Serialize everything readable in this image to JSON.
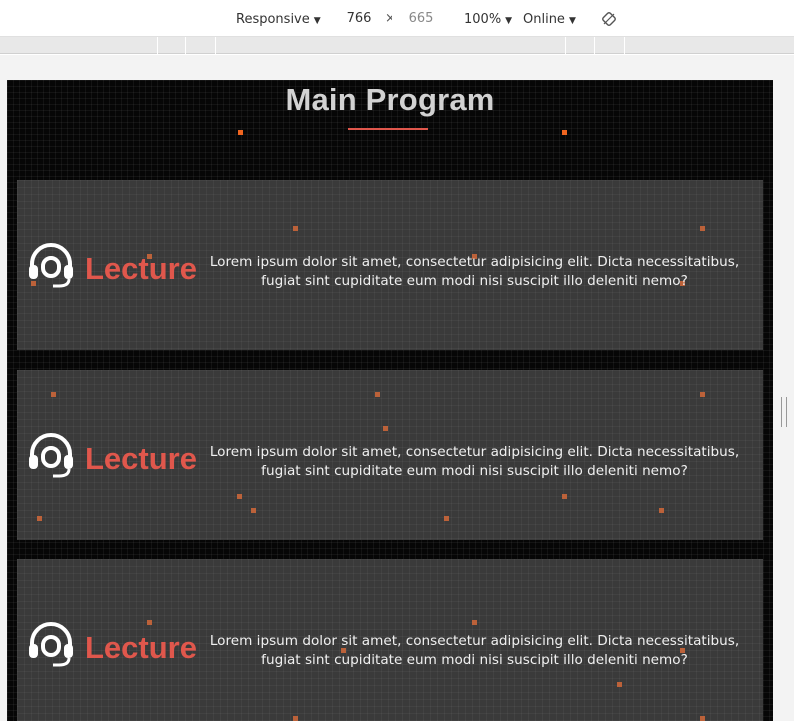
{
  "devtools": {
    "device": "Responsive",
    "width": "766",
    "height": "665",
    "times": "×",
    "zoom": "100%",
    "network": "Online",
    "icons": [
      "rotate-icon",
      "chevron-down-icon"
    ]
  },
  "page": {
    "title": "Main Program",
    "accent_color": "#e0574c",
    "cards": [
      {
        "icon": "headset-icon",
        "label": "Lecture",
        "text": "Lorem ipsum dolor sit amet, consectetur adipisicing elit. Dicta necessitatibus, fugiat sint cupiditate eum modi nisi suscipit illo deleniti nemo?"
      },
      {
        "icon": "headset-icon",
        "label": "Lecture",
        "text": "Lorem ipsum dolor sit amet, consectetur adipisicing elit. Dicta necessitatibus, fugiat sint cupiditate eum modi nisi suscipit illo deleniti nemo?"
      },
      {
        "icon": "headset-icon",
        "label": "Lecture",
        "text": "Lorem ipsum dolor sit amet, consectetur adipisicing elit. Dicta necessitatibus, fugiat sint cupiditate eum modi nisi suscipit illo deleniti nemo?"
      }
    ]
  }
}
